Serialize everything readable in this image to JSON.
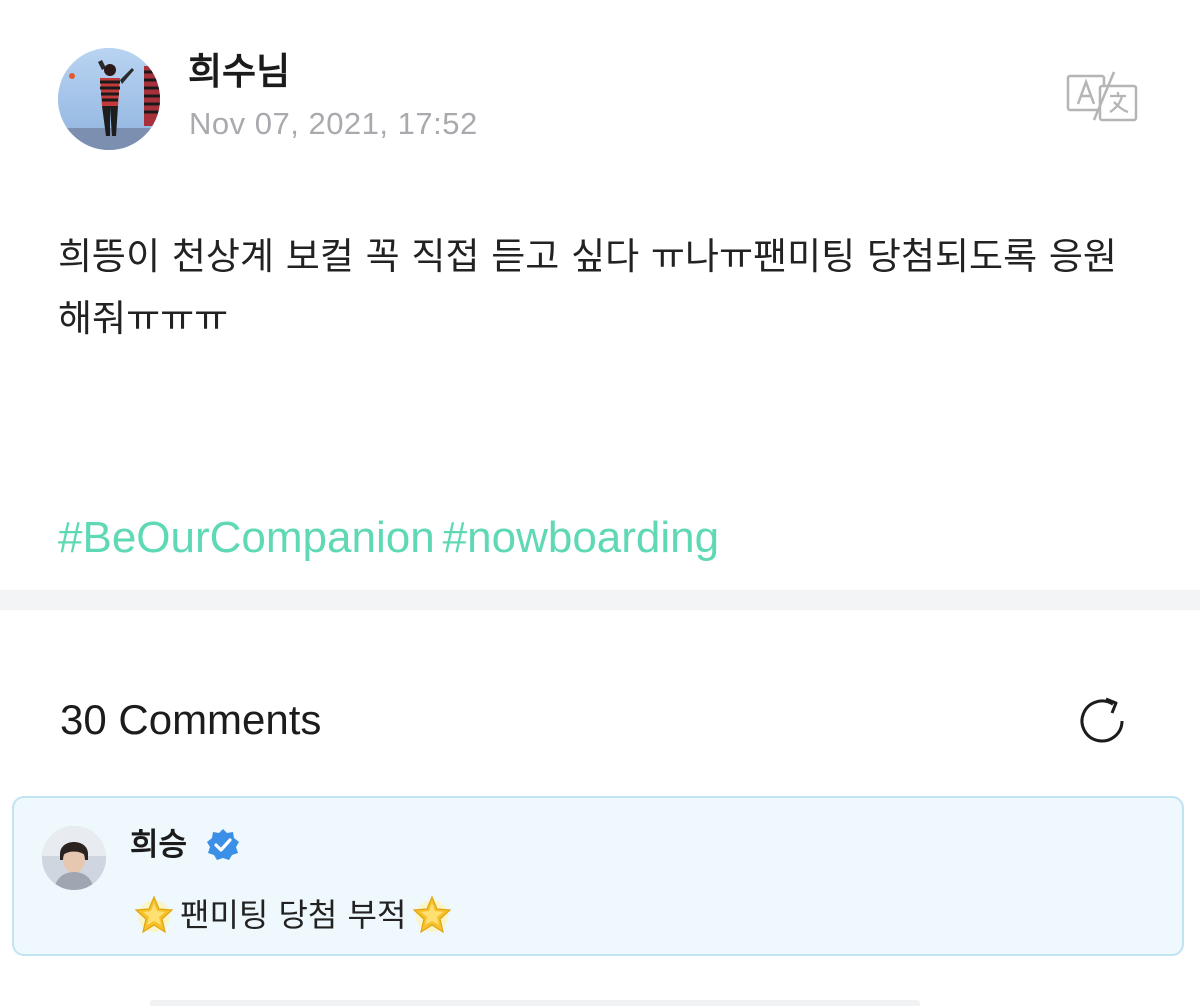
{
  "post": {
    "author": "희수님",
    "date": "Nov 07, 2021, 17:52",
    "body": "희뜽이 천상계 보컬 꼭 직접 듣고 싶다 ㅠ나ㅠ팬미팅 당첨되도록 응원해줘ㅠㅠㅠ",
    "hashtags": [
      "#BeOurCompanion",
      "#nowboarding"
    ],
    "translate_icon": "translate-icon"
  },
  "comments": {
    "count_label": "30 Comments",
    "refresh_icon": "refresh-icon",
    "items": [
      {
        "author": "희승",
        "verified": true,
        "text": "팬미팅 당첨 부적",
        "leading_icon": "glowing-star-icon",
        "trailing_icon": "glowing-star-icon"
      }
    ]
  },
  "colors": {
    "hashtag": "#5fd8b6",
    "date": "#a9a9ae",
    "comment_bg": "#eef8fd",
    "comment_border": "#bfe3f1",
    "verified": "#3b8fe6",
    "divider": "#f3f4f6"
  }
}
